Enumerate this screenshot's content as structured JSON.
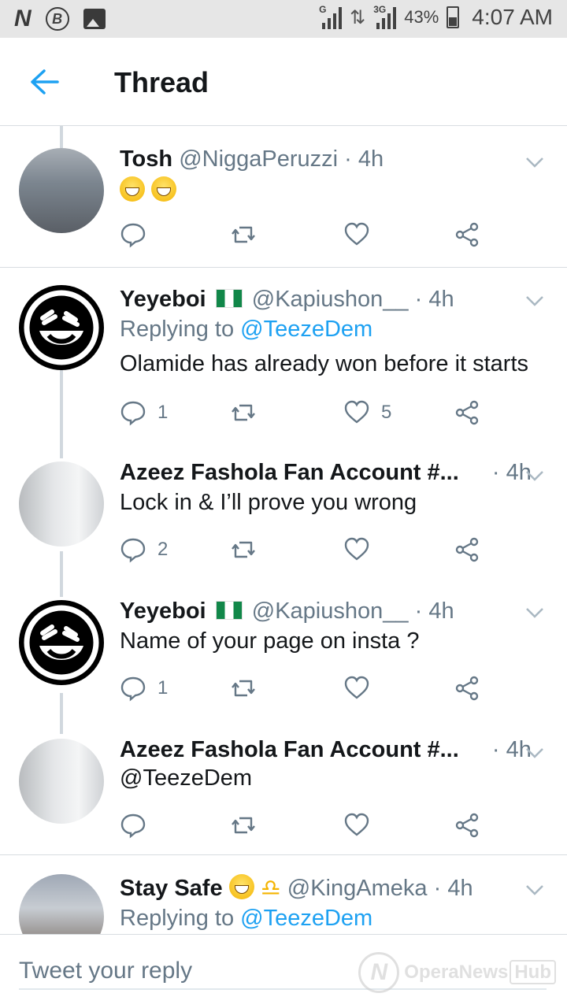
{
  "status_bar": {
    "left_icons": [
      "n-app-icon",
      "b-app-icon",
      "gallery-icon"
    ],
    "network_1": "G",
    "network_2": "3G",
    "battery": "43%",
    "time": "4:07 AM"
  },
  "app_bar": {
    "title": "Thread"
  },
  "tweets": [
    {
      "name": "Tosh",
      "handle": "@NiggaPeruzzi",
      "dot": "·",
      "time": "4h",
      "reply_count": "",
      "like_count": ""
    },
    {
      "name": "Yeyeboi",
      "handle": "@Kapiushon__",
      "dot": "·",
      "time": "4h",
      "replying_label": "Replying to",
      "replying_to": "@TeezeDem",
      "text": "Olamide has already won before it starts",
      "reply_count": "1",
      "like_count": "5"
    },
    {
      "name": "Azeez Fashola Fan Account #...",
      "dot": "·",
      "time": "4h",
      "text": "Lock in & I’ll prove you wrong",
      "reply_count": "2",
      "like_count": ""
    },
    {
      "name": "Yeyeboi",
      "handle": "@Kapiushon__",
      "dot": "·",
      "time": "4h",
      "text": "Name of your page on insta ?",
      "reply_count": "1",
      "like_count": ""
    },
    {
      "name": "Azeez Fashola Fan Account #...",
      "dot": "·",
      "time": "4h",
      "text": "@TeezeDem",
      "reply_count": "",
      "like_count": ""
    },
    {
      "name": "Stay Safe",
      "handle": "@KingAmeka",
      "dot": "·",
      "time": "4h",
      "replying_label": "Replying to",
      "replying_to": "@TeezeDem"
    }
  ],
  "reply_bar": {
    "placeholder": "Tweet your reply"
  },
  "watermark": {
    "text": "OperaNews",
    "hub": "Hub"
  },
  "colors": {
    "link": "#1da1f2",
    "muted": "#657786",
    "divider": "#d8dde1",
    "thread_line": "#d1d8de",
    "flag_green": "#118749"
  }
}
